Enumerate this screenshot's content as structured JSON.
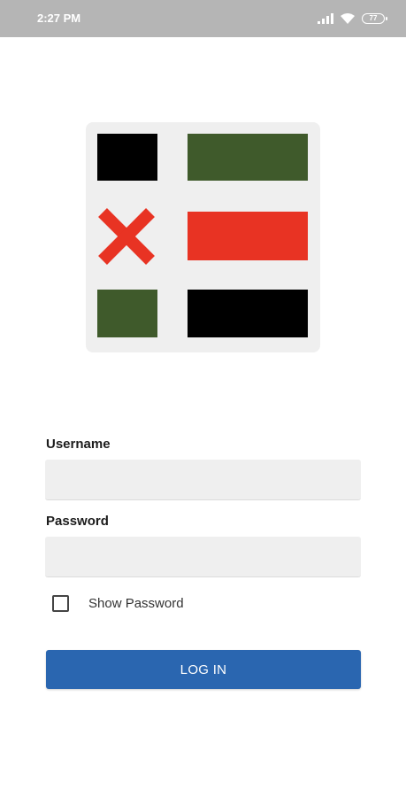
{
  "status_bar": {
    "time": "2:27 PM",
    "battery": "77",
    "icons": [
      "signal-icon",
      "wifi-icon",
      "battery-icon"
    ]
  },
  "logo": {
    "colors": {
      "black": "#000000",
      "green": "#3f5a2b",
      "red": "#e83323",
      "background": "#efefef"
    },
    "icons": [
      "x-mark-icon"
    ]
  },
  "form": {
    "username_label": "Username",
    "username_value": "",
    "password_label": "Password",
    "password_value": "",
    "show_password_label": "Show Password",
    "show_password_checked": false,
    "login_button_label": "LOG IN"
  },
  "theme": {
    "accent": "#2a66b0",
    "field_background": "#efefef",
    "status_bar_background": "#b5b5b5"
  }
}
